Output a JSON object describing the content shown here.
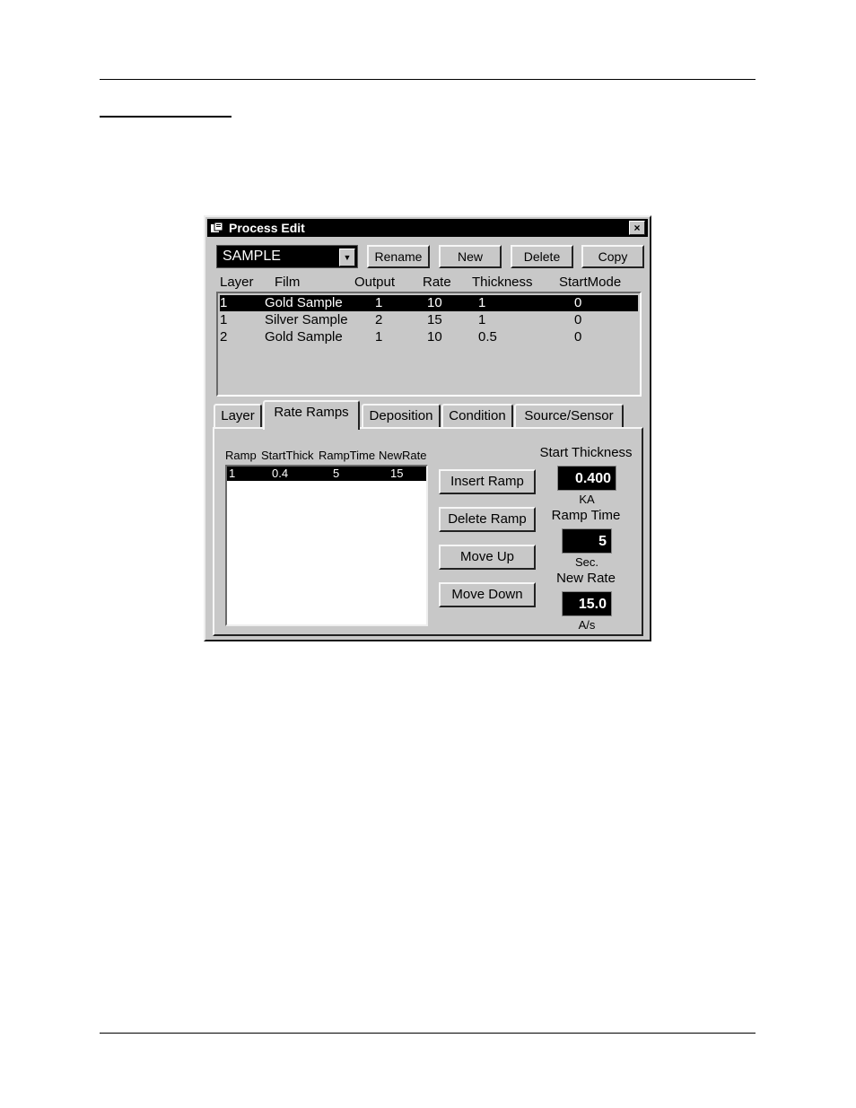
{
  "window": {
    "title": "Process Edit",
    "close_glyph": "×"
  },
  "process": {
    "selected": "SAMPLE",
    "dropdown_glyph": "▼"
  },
  "buttons": {
    "rename": "Rename",
    "new": "New",
    "delete": "Delete",
    "copy": "Copy"
  },
  "layers": {
    "columns": [
      "Layer",
      "Film",
      "Output",
      "Rate",
      "Thickness",
      "StartMode"
    ],
    "rows": [
      {
        "layer": "1",
        "film": "Gold Sample",
        "output": "1",
        "rate": "10",
        "thickness": "1",
        "startmode": "0",
        "selected": true
      },
      {
        "layer": "1",
        "film": "Silver Sample",
        "output": "2",
        "rate": "15",
        "thickness": "1",
        "startmode": "0",
        "selected": false
      },
      {
        "layer": "2",
        "film": "Gold Sample",
        "output": "1",
        "rate": "10",
        "thickness": "0.5",
        "startmode": "0",
        "selected": false
      }
    ]
  },
  "tabs": [
    "Layer",
    "Rate Ramps",
    "Deposition",
    "Condition",
    "Source/Sensor"
  ],
  "active_tab": "Rate Ramps",
  "ramps": {
    "columns": [
      "Ramp",
      "StartThick",
      "RampTime",
      "NewRate"
    ],
    "rows": [
      {
        "ramp": "1",
        "startthick": "0.4",
        "ramptime": "5",
        "newrate": "15",
        "selected": true
      }
    ]
  },
  "ramp_buttons": {
    "insert": "Insert Ramp",
    "delete": "Delete Ramp",
    "up": "Move Up",
    "down": "Move Down"
  },
  "fields": {
    "start_thickness": {
      "label": "Start Thickness",
      "value": "0.400",
      "unit": "KA"
    },
    "ramp_time": {
      "label": "Ramp Time",
      "value": "5",
      "unit": "Sec."
    },
    "new_rate": {
      "label": "New Rate",
      "value": "15.0",
      "unit": "A/s"
    }
  }
}
